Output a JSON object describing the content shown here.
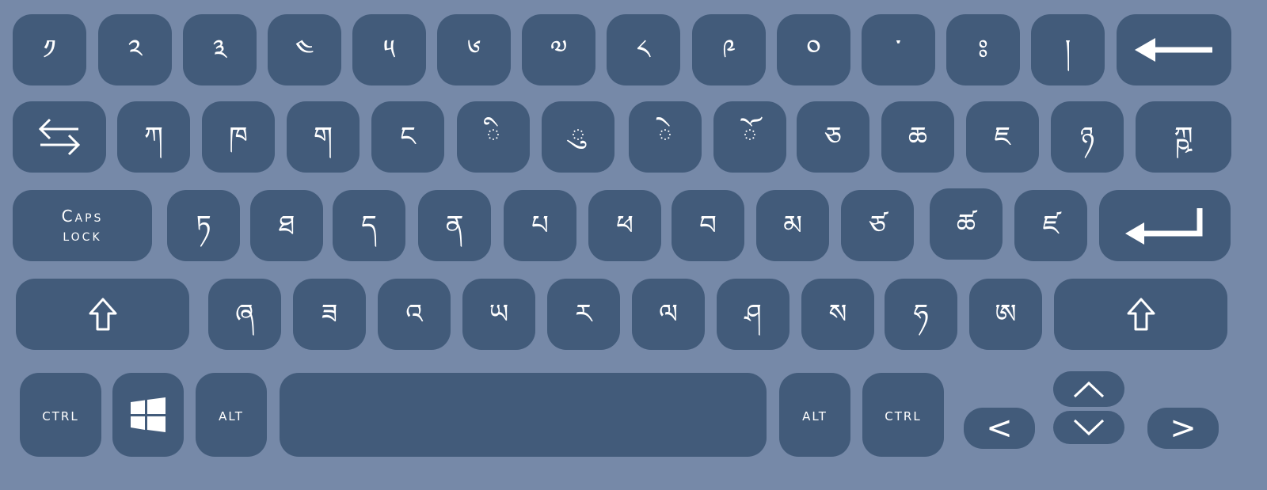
{
  "colors": {
    "background": "#7689a8",
    "key": "#425b7a",
    "foreground": "#ffffff"
  },
  "rows": {
    "number_row": [
      {
        "label": "༡"
      },
      {
        "label": "༢"
      },
      {
        "label": "༣"
      },
      {
        "label": "༤"
      },
      {
        "label": "༥"
      },
      {
        "label": "༦"
      },
      {
        "label": "༧"
      },
      {
        "label": "༨"
      },
      {
        "label": "༩"
      },
      {
        "label": "༠"
      },
      {
        "label": "་"
      },
      {
        "label": "ཿ"
      },
      {
        "label": "།"
      }
    ],
    "qwerty_row": [
      {
        "label": "ཀ"
      },
      {
        "label": "ཁ"
      },
      {
        "label": "ག"
      },
      {
        "label": "ང"
      },
      {
        "label": "ི"
      },
      {
        "label": "ུ"
      },
      {
        "label": "ེ"
      },
      {
        "label": "ོ"
      },
      {
        "label": "ཅ"
      },
      {
        "label": "ཆ"
      },
      {
        "label": "ཇ"
      },
      {
        "label": "ཉ"
      },
      {
        "label": "ཀྵ"
      }
    ],
    "home_row": [
      {
        "label": "ཏ"
      },
      {
        "label": "ཐ"
      },
      {
        "label": "ད"
      },
      {
        "label": "ན"
      },
      {
        "label": "པ"
      },
      {
        "label": "ཕ"
      },
      {
        "label": "བ"
      },
      {
        "label": "མ"
      },
      {
        "label": "ཙ"
      },
      {
        "label": "ཚ"
      },
      {
        "label": "ཛ"
      }
    ],
    "bottom_row": [
      {
        "label": "ཞ"
      },
      {
        "label": "ཟ"
      },
      {
        "label": "འ"
      },
      {
        "label": "ཡ"
      },
      {
        "label": "ར"
      },
      {
        "label": "ལ"
      },
      {
        "label": "ཤ"
      },
      {
        "label": "ས"
      },
      {
        "label": "ཧ"
      },
      {
        "label": "ཨ"
      }
    ]
  },
  "modifiers": {
    "backspace_icon": "left-arrow-icon",
    "tab_icon": "tab-arrows-icon",
    "caps_line1": "Caps",
    "caps_line2": "lock",
    "enter_icon": "enter-arrow-icon",
    "shift_icon": "shift-arrow-icon",
    "ctrl_left": "ctrl",
    "windows_icon": "windows-logo-icon",
    "alt_left": "alt",
    "alt_right": "alt",
    "ctrl_right": "ctrl",
    "arrow_left": "<",
    "arrow_right": ">"
  }
}
